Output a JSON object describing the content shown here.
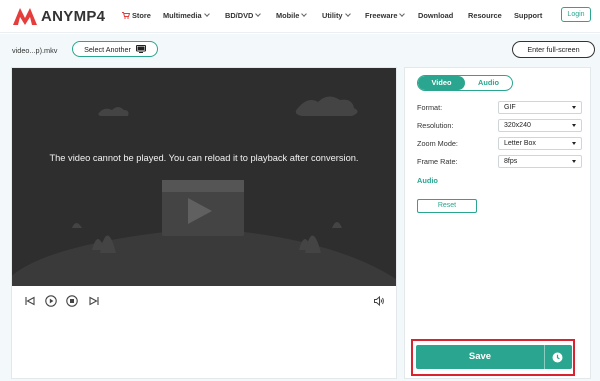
{
  "brand": {
    "name": "ANYMP4",
    "accent_color": "#2aa58f",
    "logo_color": "#e43d3b"
  },
  "nav": {
    "items": [
      {
        "label": "Store",
        "icon": "cart-icon",
        "has_dropdown": false
      },
      {
        "label": "Multimedia",
        "has_dropdown": true
      },
      {
        "label": "BD/DVD",
        "has_dropdown": true
      },
      {
        "label": "Mobile",
        "has_dropdown": true
      },
      {
        "label": "Utility",
        "has_dropdown": true
      },
      {
        "label": "Freeware",
        "has_dropdown": true
      },
      {
        "label": "Download",
        "has_dropdown": false
      },
      {
        "label": "Resource",
        "has_dropdown": false
      },
      {
        "label": "Support",
        "has_dropdown": false
      }
    ],
    "login_label": "Login"
  },
  "toolbar": {
    "file_name": "video...p).mkv",
    "select_another_label": "Select Another",
    "select_another_icon": "monitor-icon",
    "fullscreen_label": "Enter full-screen"
  },
  "player": {
    "message": "The video cannot be played. You can reload it to playback after conversion.",
    "controls": [
      "previous-icon",
      "play-icon",
      "stop-icon",
      "next-icon",
      "volume-icon"
    ]
  },
  "settings": {
    "tabs": [
      {
        "label": "Video",
        "active": true
      },
      {
        "label": "Audio",
        "active": false
      }
    ],
    "video_rows": [
      {
        "label": "Format:",
        "value": "GIF"
      },
      {
        "label": "Resolution:",
        "value": "320x240"
      },
      {
        "label": "Zoom Mode:",
        "value": "Letter Box"
      },
      {
        "label": "Frame Rate:",
        "value": "8fps"
      }
    ],
    "audio_heading": "Audio",
    "reset_label": "Reset",
    "save_label": "Save",
    "save_icon": "clock-icon",
    "highlight_color": "#d9232e"
  }
}
